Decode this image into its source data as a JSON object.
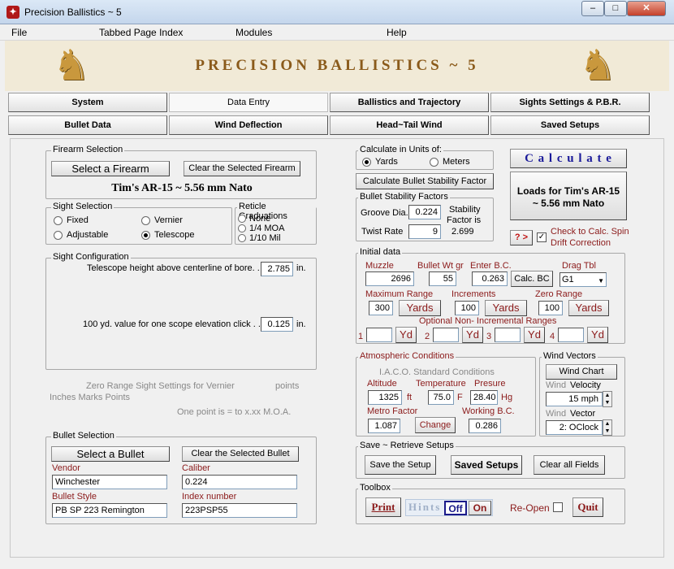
{
  "window": {
    "title": "Precision Ballistics ~ 5",
    "minimize": "–",
    "maximize": "□",
    "close": "✕"
  },
  "menu": [
    "File",
    "Tabbed Page Index",
    "Modules",
    "Help"
  ],
  "app_title": "PRECISION BALLISTICS ~ 5",
  "tabs_row1": [
    "System",
    "Data Entry",
    "Ballistics and Trajectory",
    "Sights Settings & P.B.R."
  ],
  "tabs_row2": [
    "Bullet Data",
    "Wind Deflection",
    "Head~Tail Wind",
    "Saved Setups"
  ],
  "firearm": {
    "legend": "Firearm Selection",
    "select_btn": "Select  a  Firearm",
    "clear_btn": "Clear the Selected Firearm",
    "name": "Tim's AR-15  ~  5.56 mm Nato"
  },
  "sight_sel": {
    "legend": "Sight Selection",
    "fixed": "Fixed",
    "vernier": "Vernier",
    "adjustable": "Adjustable",
    "telescope": "Telescope"
  },
  "reticle": {
    "legend": "Reticle Graduations",
    "none": "None",
    "moa": "1/4 MOA",
    "mil": "1/10 Mil"
  },
  "sight_config": {
    "legend": "Sight Configuration",
    "height_label": "Telescope height above centerline of bore. .",
    "height_value": "2.785",
    "height_unit": "in.",
    "click_label": "100 yd. value for one scope elevation click . .",
    "click_value": "0.125",
    "click_unit": "in."
  },
  "vernier": {
    "line1a": "Zero Range Sight Settings for Vernier",
    "line1b": "points",
    "line2": "Inches    Marks    Points",
    "line3": "One point is  =  to  x.xx M.O.A."
  },
  "bullet_sel": {
    "legend": "Bullet Selection",
    "select_btn": "Select  a  Bullet",
    "clear_btn": "Clear the Selected Bullet",
    "vendor_label": "Vendor",
    "vendor": "Winchester",
    "caliber_label": "Caliber",
    "caliber": "0.224",
    "style_label": "Bullet Style",
    "style": "PB SP 223 Remington",
    "index_label": "Index number",
    "index": "223PSP55"
  },
  "units": {
    "legend": "Calculate in Units of:",
    "yards": "Yards",
    "meters": "Meters"
  },
  "stab_btn": "Calculate Bullet Stability Factor",
  "stability": {
    "legend": "Bullet Stability Factors",
    "groove_label": "Groove Dia.",
    "groove": "0.224",
    "twist_label": "Twist Rate",
    "twist": "9",
    "factor_label1": "Stability",
    "factor_label2": "Factor is",
    "factor": "2.699"
  },
  "calculate_btn": "C a l c u l a t e",
  "loads_btn": "Loads for Tim's AR-15 ~ 5.56 mm Nato",
  "help_btn": "? >",
  "spin": {
    "checked": "✓",
    "label": "Check to Calc. Spin Drift Correction"
  },
  "initial": {
    "legend": "Initial data",
    "muzzle_label": "Muzzle",
    "muzzle": "2696",
    "wt_label": "Bullet Wt gr",
    "wt": "55",
    "bc_label": "Enter B.C.",
    "bc": "0.263",
    "calc_bc": "Calc. BC",
    "drag_label": "Drag Tbl",
    "drag": "G1",
    "max_label": "Maximum Range",
    "max": "300",
    "yards": "Yards",
    "inc_label": "Increments",
    "inc": "100",
    "zero_label": "Zero Range",
    "zero": "100",
    "opt_label": "Optional  Non- Incremental Ranges",
    "n1": "1",
    "n2": "2",
    "n3": "3",
    "n4": "4",
    "yd": "Yd"
  },
  "atmos": {
    "legend": "Atmospheric Conditions",
    "std": "I.A.C.O. Standard Conditions",
    "alt_label": "Altitude",
    "alt": "1325",
    "alt_unit": "ft",
    "temp_label": "Temperature",
    "temp": "75.0",
    "temp_unit": "F",
    "pres_label": "Presure",
    "pres": "28.40",
    "pres_unit": "Hg",
    "metro_label": "Metro Factor",
    "metro": "1.087",
    "change": "Change",
    "wbc_label": "Working B.C.",
    "wbc": "0.286"
  },
  "wind": {
    "legend": "Wind Vectors",
    "chart_btn": "Wind Chart",
    "wind1": "Wind",
    "vel_label": "Velocity",
    "vel": "15 mph",
    "wind2": "Wind",
    "vec_label": "Vector",
    "vec": "2: OClock"
  },
  "save": {
    "legend": "Save ~ Retrieve Setups",
    "save_btn": "Save the Setup",
    "saved_btn": "Saved Setups",
    "clear_btn": "Clear all Fields"
  },
  "toolbox": {
    "legend": "Toolbox",
    "print": "Print",
    "hints": "Hints",
    "off": "Off",
    "on": "On",
    "reopen": "Re-Open",
    "quit": "Quit"
  }
}
